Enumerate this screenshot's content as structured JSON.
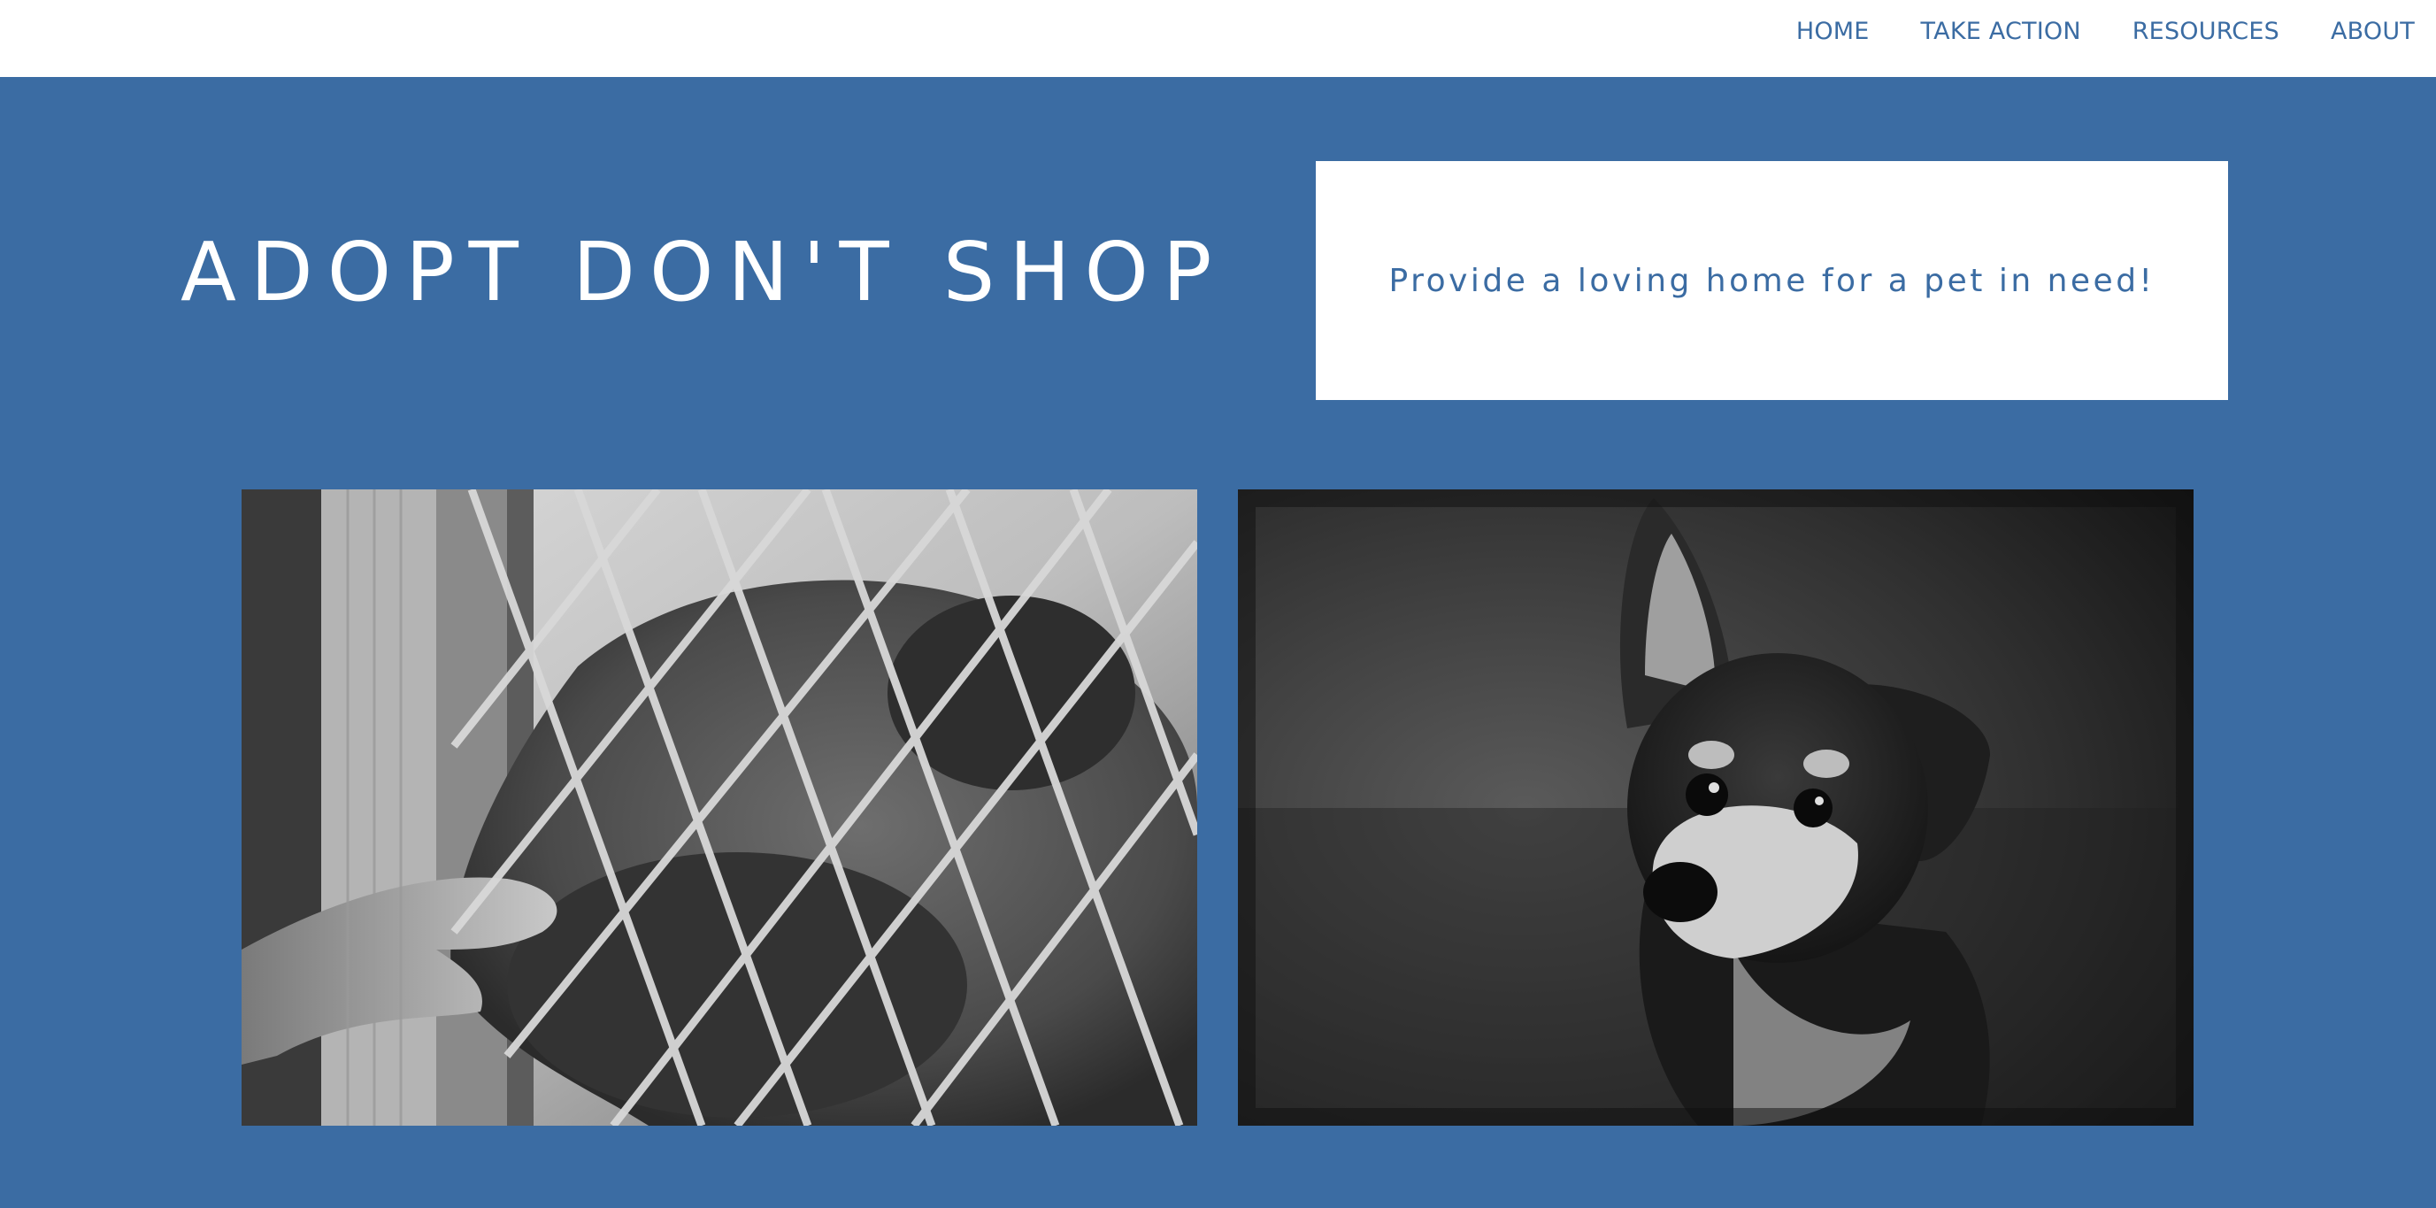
{
  "nav": {
    "items": [
      {
        "label": "HOME"
      },
      {
        "label": "TAKE ACTION"
      },
      {
        "label": "RESOURCES"
      },
      {
        "label": "ABOUT"
      }
    ]
  },
  "hero": {
    "title": "ADOPT DON'T SHOP",
    "tagline": "Provide a loving home for a pet in need!"
  },
  "photos": [
    {
      "icon": "dog-behind-fence-photo"
    },
    {
      "icon": "small-dog-portrait-photo"
    }
  ],
  "colors": {
    "brand_blue": "#3b6ca3",
    "white": "#ffffff"
  }
}
